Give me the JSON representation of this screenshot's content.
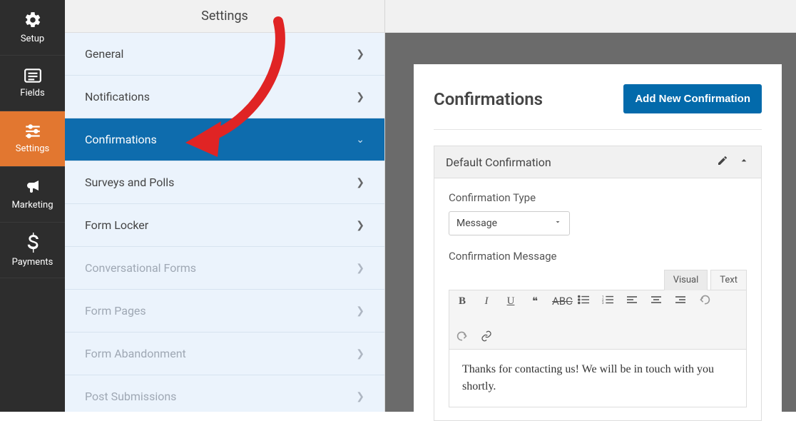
{
  "rail": {
    "items": [
      {
        "label": "Setup",
        "icon": "gear"
      },
      {
        "label": "Fields",
        "icon": "list"
      },
      {
        "label": "Settings",
        "icon": "sliders",
        "active": true
      },
      {
        "label": "Marketing",
        "icon": "bullhorn"
      },
      {
        "label": "Payments",
        "icon": "dollar"
      }
    ]
  },
  "mid": {
    "title": "Settings",
    "items": [
      {
        "label": "General"
      },
      {
        "label": "Notifications"
      },
      {
        "label": "Confirmations",
        "active": true,
        "expanded": true
      },
      {
        "label": "Surveys and Polls"
      },
      {
        "label": "Form Locker"
      },
      {
        "label": "Conversational Forms",
        "disabled": true
      },
      {
        "label": "Form Pages",
        "disabled": true
      },
      {
        "label": "Form Abandonment",
        "disabled": true
      },
      {
        "label": "Post Submissions",
        "disabled": true
      }
    ]
  },
  "main": {
    "title": "Confirmations",
    "add_btn": "Add New Confirmation",
    "panel_title": "Default Confirmation",
    "type_label": "Confirmation Type",
    "type_value": "Message",
    "msg_label": "Confirmation Message",
    "tabs": {
      "visual": "Visual",
      "text": "Text"
    },
    "editor_content": "Thanks for contacting us! We will be in touch with you shortly."
  }
}
